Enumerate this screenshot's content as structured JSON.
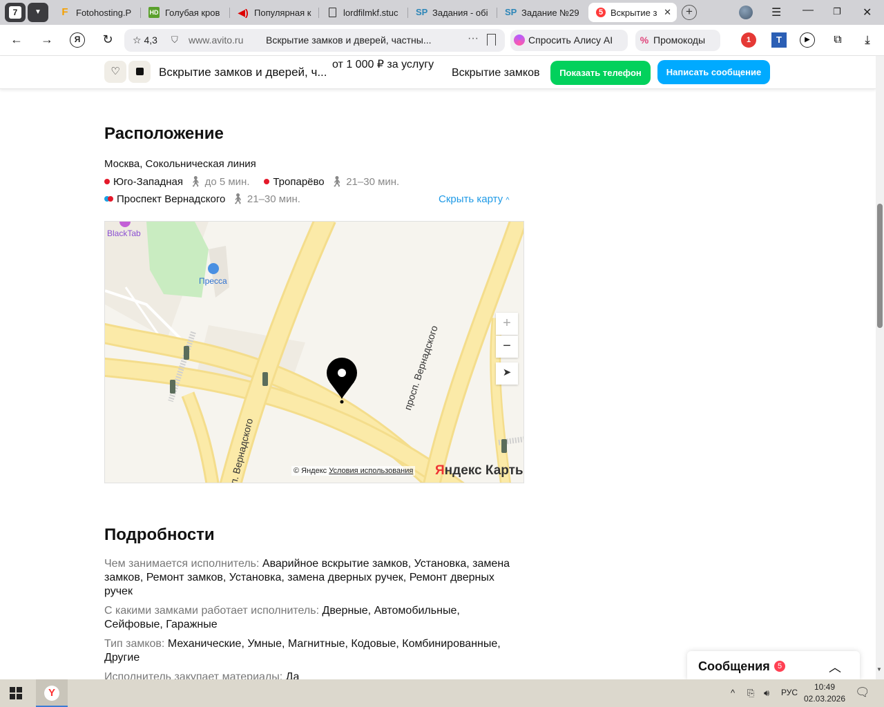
{
  "browser": {
    "tab_count": "7",
    "tabs": [
      {
        "title": "Fotohosting.P",
        "icon": "F"
      },
      {
        "title": "Голубая кров",
        "icon": "HD"
      },
      {
        "title": "Популярная к",
        "icon": "speaker"
      },
      {
        "title": "lordfilmkf.stuc",
        "icon": "doc"
      },
      {
        "title": "Задания - обі",
        "icon": "SP"
      },
      {
        "title": "Задание №29",
        "icon": "SP"
      },
      {
        "title": "Вскрытие з",
        "icon": "5",
        "active": true
      }
    ],
    "address": {
      "rating": "4,3",
      "domain": "www.avito.ru",
      "page_title": "Вскрытие замков и дверей, частны..."
    },
    "alice_label": "Спросить Алису AI",
    "promo_label": "Промокоды",
    "ext_badge": "1"
  },
  "sticky_header": {
    "title": "Вскрытие замков и дверей, ч...",
    "price": "от 1 000 ₽ за услугу",
    "category": "Вскрытие замков",
    "show_phone": "Показать телефон",
    "write_message": "Написать сообщение"
  },
  "location": {
    "heading": "Расположение",
    "address": "Москва, Сокольническая линия",
    "metro": [
      {
        "name": "Юго-Западная",
        "walk": "до 5 мин.",
        "color": "#e4192a"
      },
      {
        "name": "Тропарёво",
        "walk": "21–30 мин.",
        "color": "#e4192a"
      },
      {
        "name": "Проспект Вернадского",
        "walk": "21–30 мин.",
        "colors": [
          "#1aa1e3",
          "#e4192a"
        ]
      }
    ],
    "hide_map": "Скрыть карту"
  },
  "map": {
    "poi": [
      "BlackTab",
      "Пресса"
    ],
    "streets": [
      "просп. Вернадского",
      "п. Вернадского"
    ],
    "copyright": "© Яндекс",
    "terms": "Условия использования",
    "brand_letter": "Я",
    "brand_rest": "ндекс Карты",
    "zoom_in": "+",
    "zoom_out": "−"
  },
  "details": {
    "heading": "Подробности",
    "rows": [
      {
        "key": "Чем занимается исполнитель:",
        "value": "Аварийное вскрытие замков, Установка, замена замков, Ремонт замков, Установка, замена дверных ручек, Ремонт дверных ручек"
      },
      {
        "key": "С какими замками работает исполнитель:",
        "value": "Дверные, Автомобильные, Сейфовые, Гаражные"
      },
      {
        "key": "Тип замков:",
        "value": "Механические, Умные, Магнитные, Кодовые, Комбинированные, Другие"
      },
      {
        "key": "Исполнитель закупает материалы:",
        "value": "Да"
      }
    ]
  },
  "messages": {
    "label": "Сообщения",
    "count": "5"
  },
  "taskbar": {
    "lang": "РУС",
    "time": "10:49",
    "date": "02.03.2026"
  }
}
